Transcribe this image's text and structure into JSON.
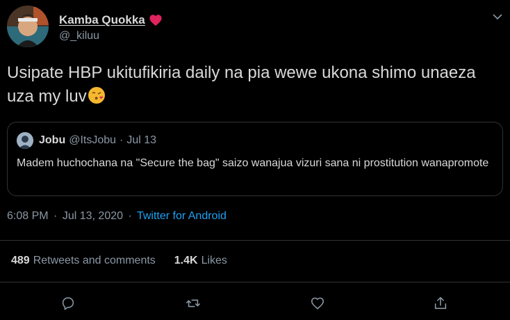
{
  "author": {
    "display_name": "Kamba Quokka",
    "handle": "@_kiluu",
    "name_badge_icon": "heart-icon"
  },
  "tweet": {
    "text": "Usipate HBP ukitufikiria daily na pia wewe ukona shimo unaeza uza my luv",
    "emoji_icon": "face-blowing-kiss-icon"
  },
  "quoted": {
    "name": "Jobu",
    "handle": "@ItsJobu",
    "separator": "·",
    "date": "Jul 13",
    "text": "Madem huchochana na \"Secure the bag\" saizo wanajua vizuri sana ni prostitution wanapromote"
  },
  "meta": {
    "time": "6:08 PM",
    "separator": "·",
    "date": "Jul 13, 2020",
    "source": "Twitter for Android"
  },
  "stats": {
    "retweets_count": "489",
    "retweets_label": "Retweets and comments",
    "likes_count": "1.4K",
    "likes_label": "Likes"
  },
  "actions": [
    "reply-icon",
    "retweet-icon",
    "like-icon",
    "share-icon"
  ],
  "colors": {
    "background": "#000000",
    "text": "#d9d9d9",
    "secondary": "#8b98a5",
    "link": "#1da1f2",
    "heart": "#e0245e",
    "border": "#2f3336"
  }
}
